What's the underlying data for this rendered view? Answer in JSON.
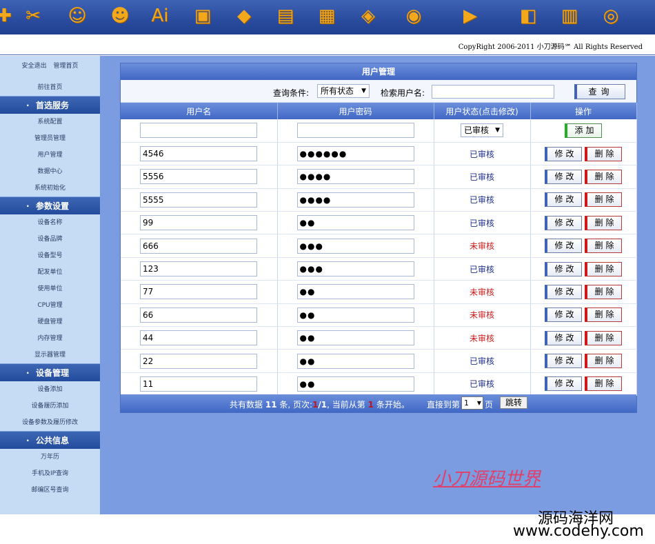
{
  "top_icons": [
    {
      "icon": "tools-icon",
      "glyph": "✚"
    },
    {
      "icon": "tools-icon",
      "glyph": "✂"
    },
    {
      "icon": "user-icon",
      "glyph": "☺"
    },
    {
      "icon": "users-icon",
      "glyph": "☻"
    },
    {
      "icon": "ai-icon",
      "glyph": "Ai"
    },
    {
      "icon": "briefcase-icon",
      "glyph": "▣"
    },
    {
      "icon": "chip-icon",
      "glyph": "◆"
    },
    {
      "icon": "harddisk-icon",
      "glyph": "▤"
    },
    {
      "icon": "board-icon",
      "glyph": "▦"
    },
    {
      "icon": "disc-icon",
      "glyph": "◈"
    },
    {
      "icon": "photo-icon",
      "glyph": "◉"
    },
    {
      "icon": "clapper-icon",
      "glyph": "▶"
    },
    {
      "icon": "package-icon",
      "glyph": "◧"
    },
    {
      "icon": "calendar-icon",
      "glyph": "▥"
    },
    {
      "icon": "link-icon",
      "glyph": "◎"
    }
  ],
  "copyright": "CopyRight 2006-2011 小刀源码℠ All Rights Reserved",
  "sidebar": {
    "top_links": [
      "安全退出",
      "管理首页"
    ],
    "home_link": "前往首页",
    "sections": [
      {
        "title": "首选服务",
        "items": [
          "系统配置",
          "管理员管理",
          "用户管理",
          "数据中心",
          "系统初始化"
        ]
      },
      {
        "title": "参数设置",
        "items": [
          "设备名称",
          "设备品牌",
          "设备型号",
          "配发单位",
          "使用单位",
          "CPU管理",
          "硬盘管理",
          "内存管理",
          "显示器管理"
        ]
      },
      {
        "title": "设备管理",
        "items": [
          "设备添加",
          "设备履历添加",
          "设备参数及履历修改"
        ]
      },
      {
        "title": "公共信息",
        "items": [
          "万年历",
          "手机及IP查询",
          "邮编区号查询"
        ]
      }
    ]
  },
  "panel": {
    "title": "用户管理",
    "query_label": "查询条件:",
    "query_value": "所有状态",
    "search_label": "检索用户名:",
    "search_value": "",
    "query_button": "查询",
    "columns": [
      "用户名",
      "用户密码",
      "用户状态(点击修改)",
      "操作"
    ],
    "new_row": {
      "status": "已审核",
      "add_button": "添加"
    },
    "rows": [
      {
        "username": "4546",
        "password": "●●●●●●",
        "status": "已审核",
        "approved": true
      },
      {
        "username": "5556",
        "password": "●●●●",
        "status": "已审核",
        "approved": true
      },
      {
        "username": "5555",
        "password": "●●●●",
        "status": "已审核",
        "approved": true
      },
      {
        "username": "99",
        "password": "●●",
        "status": "已审核",
        "approved": true
      },
      {
        "username": "666",
        "password": "●●●",
        "status": "未审核",
        "approved": false
      },
      {
        "username": "123",
        "password": "●●●",
        "status": "已审核",
        "approved": true
      },
      {
        "username": "77",
        "password": "●●",
        "status": "未审核",
        "approved": false
      },
      {
        "username": "66",
        "password": "●●",
        "status": "未审核",
        "approved": false
      },
      {
        "username": "44",
        "password": "●●",
        "status": "未审核",
        "approved": false
      },
      {
        "username": "22",
        "password": "●●",
        "status": "已审核",
        "approved": true
      },
      {
        "username": "11",
        "password": "●●",
        "status": "已审核",
        "approved": true
      }
    ],
    "edit_label": "修改",
    "delete_label": "删除",
    "footer": {
      "text1": "共有数据",
      "total": "11",
      "text2": "条, 页次:",
      "current_page": "1",
      "total_pages": "/1",
      "text3": ", 当前从第",
      "start": "1",
      "text4": "条开始。",
      "jump_label": "直接到第",
      "page_value": "1",
      "page_unit": "页",
      "jump_button": "跳转"
    }
  },
  "watermark": {
    "site_name": "小刀源码世界",
    "line1": "源码海洋网",
    "line2": "www.codehy.com"
  }
}
